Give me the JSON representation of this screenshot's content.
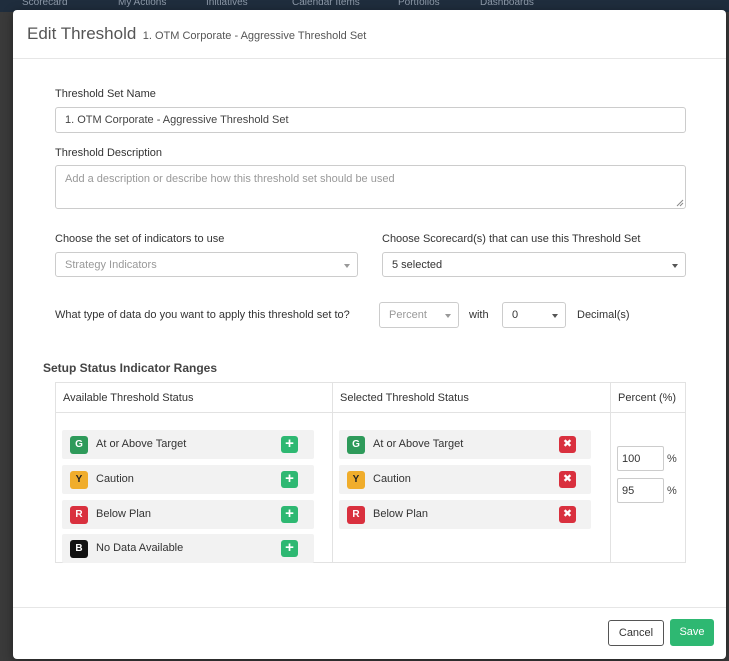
{
  "background_nav": [
    "Scorecard",
    "My Actions",
    "Initiatives",
    "Calendar Items",
    "Portfolios",
    "Dashboards"
  ],
  "modal": {
    "title": "Edit Threshold",
    "subtitle": "1. OTM Corporate - Aggressive Threshold Set"
  },
  "form": {
    "name_label": "Threshold Set Name",
    "name_value": "1. OTM Corporate - Aggressive Threshold Set",
    "description_label": "Threshold Description",
    "description_placeholder": "Add a description or describe how this threshold set should be used",
    "indicators_label": "Choose the set of indicators to use",
    "indicators_value": "Strategy Indicators",
    "scorecards_label": "Choose Scorecard(s) that can use this Threshold Set",
    "scorecards_value": "5 selected",
    "data_type_question": "What type of data do you want to apply this threshold set to?",
    "data_type_value": "Percent",
    "with_label": "with",
    "decimals_value": "0",
    "decimals_label": "Decimal(s)"
  },
  "ranges": {
    "section_title": "Setup Status Indicator Ranges",
    "available_header": "Available Threshold Status",
    "selected_header": "Selected Threshold Status",
    "percent_header": "Percent (%)",
    "available": [
      {
        "code": "G",
        "label": "At or Above Target",
        "color": "#2e9a5a"
      },
      {
        "code": "Y",
        "label": "Caution",
        "color": "#f0ad2c"
      },
      {
        "code": "R",
        "label": "Below Plan",
        "color": "#d9303e"
      },
      {
        "code": "B",
        "label": "No Data Available",
        "color": "#111111"
      }
    ],
    "selected": [
      {
        "code": "G",
        "label": "At or Above Target",
        "color": "#2e9a5a"
      },
      {
        "code": "Y",
        "label": "Caution",
        "color": "#f0ad2c"
      },
      {
        "code": "R",
        "label": "Below Plan",
        "color": "#d9303e"
      }
    ],
    "percent_values": [
      "100",
      "95"
    ],
    "percent_sign": "%",
    "add_icon": "plus-icon",
    "remove_icon": "x-icon"
  },
  "footer": {
    "cancel_label": "Cancel",
    "save_label": "Save"
  },
  "colors": {
    "accent_green": "#2eb872",
    "danger_red": "#d9303e"
  }
}
